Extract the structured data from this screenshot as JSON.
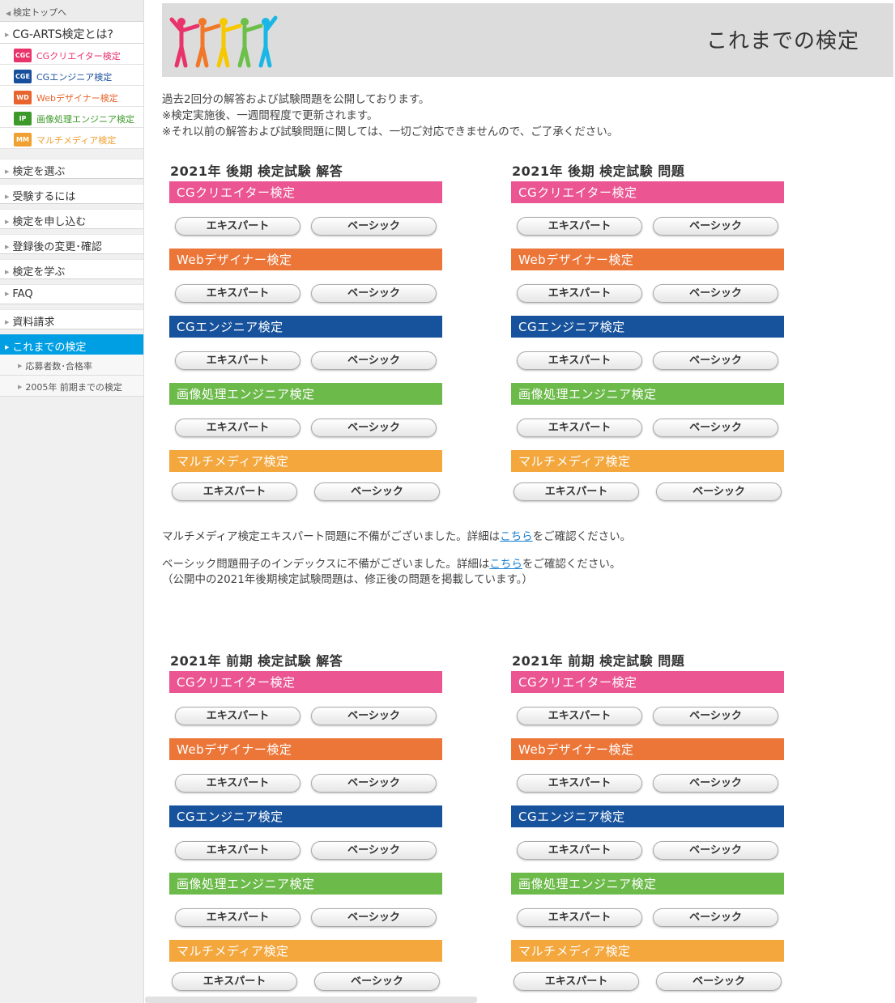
{
  "sidebar": {
    "top_link": "検定トップへ",
    "about_title": "CG-ARTS検定とは?",
    "exams": [
      {
        "abbr": "CGC",
        "label": "CGクリエイター検定",
        "color": "#e8336b"
      },
      {
        "abbr": "CGE",
        "label": "CGエンジニア検定",
        "color": "#174f9c"
      },
      {
        "abbr": "WD",
        "label": "Webデザイナー検定",
        "color": "#e8642c"
      },
      {
        "abbr": "IP",
        "label": "画像処理エンジニア検定",
        "color": "#3d9a2a"
      },
      {
        "abbr": "MM",
        "label": "マルチメディア検定",
        "color": "#f0a030"
      }
    ],
    "menu": [
      "検定を選ぶ",
      "受験するには",
      "検定を申し込む",
      "登録後の変更･確認",
      "検定を学ぶ",
      "FAQ",
      "資料請求",
      "これまでの検定"
    ],
    "sub_menu": [
      "応募者数･合格率",
      "2005年 前期までの検定"
    ]
  },
  "header": {
    "title": "これまでの検定"
  },
  "intro": [
    "過去2回分の解答および試験問題を公開しております。",
    "※検定実施後、一週間程度で更新されます。",
    "※それ以前の解答および試験問題に関しては、一切ご対応できませんので、ご了承ください。"
  ],
  "categories": [
    {
      "name": "CGクリエイター検定",
      "color": "#ea5592"
    },
    {
      "name": "Webデザイナー検定",
      "color": "#ec7538"
    },
    {
      "name": "CGエンジニア検定",
      "color": "#17529c"
    },
    {
      "name": "画像処理エンジニア検定",
      "color": "#6cba4a"
    },
    {
      "name": "マルチメディア検定",
      "color": "#f3a73d"
    }
  ],
  "buttons": {
    "expert": "エキスパート",
    "basic": "ベーシック"
  },
  "sections": [
    {
      "answers_heading": "2021年 後期 検定試験 解答",
      "questions_heading": "2021年 後期 検定試験 問題"
    },
    {
      "answers_heading": "2021年 前期 検定試験 解答",
      "questions_heading": "2021年 前期 検定試験 問題"
    }
  ],
  "notes": {
    "note1_before": "マルチメディア検定エキスパート問題に不備がございました。詳細は",
    "note1_link": "こちら",
    "note1_after": "をご確認ください。",
    "note2_before": "ベーシック問題冊子のインデックスに不備がございました。詳細は",
    "note2_link": "こちら",
    "note2_after": "をご確認ください。",
    "note3": "（公開中の2021年後期検定試験問題は、修正後の問題を掲載しています。）"
  }
}
